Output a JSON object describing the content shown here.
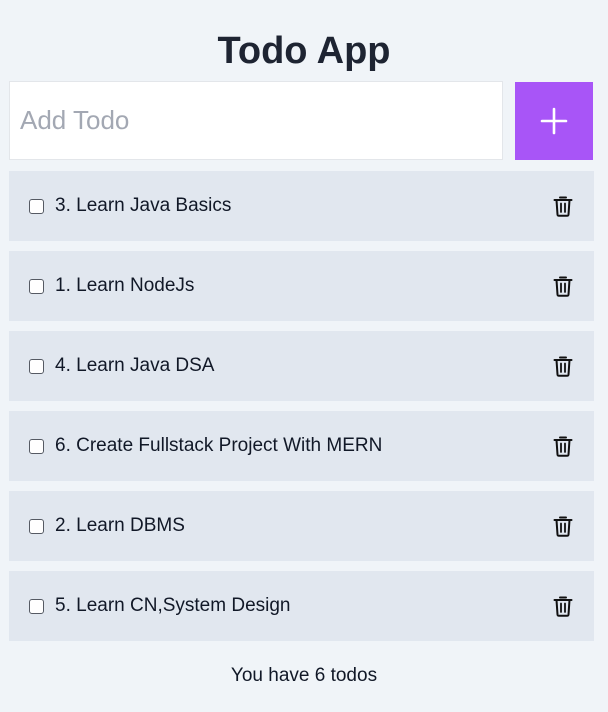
{
  "header": {
    "title": "Todo App"
  },
  "add_form": {
    "placeholder": "Add Todo",
    "value": "",
    "add_button_icon": "plus-icon",
    "accent_color": "#a855f7"
  },
  "todos": [
    {
      "text": "3. Learn Java Basics",
      "checked": false,
      "delete_icon": "trash-icon"
    },
    {
      "text": "1. Learn NodeJs",
      "checked": false,
      "delete_icon": "trash-icon"
    },
    {
      "text": "4. Learn Java DSA",
      "checked": false,
      "delete_icon": "trash-icon"
    },
    {
      "text": "6. Create Fullstack Project With MERN",
      "checked": false,
      "delete_icon": "trash-icon"
    },
    {
      "text": "2. Learn DBMS",
      "checked": false,
      "delete_icon": "trash-icon"
    },
    {
      "text": "5. Learn CN,System Design",
      "checked": false,
      "delete_icon": "trash-icon"
    }
  ],
  "footer": {
    "summary": "You have 6 todos"
  }
}
